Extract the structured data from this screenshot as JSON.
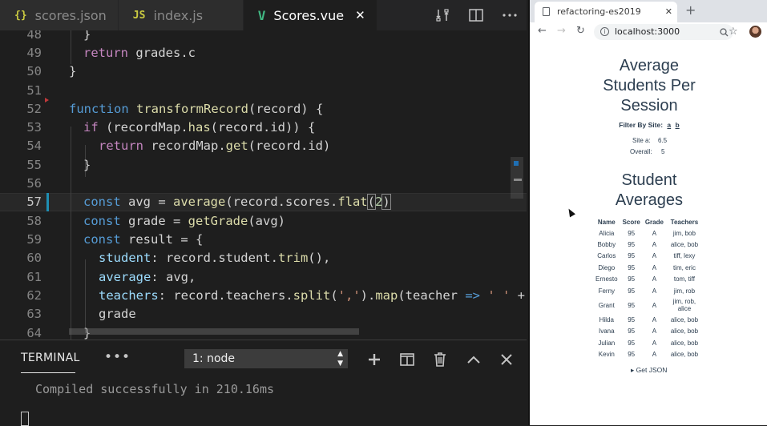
{
  "editor": {
    "tabs": [
      {
        "icon": "{}",
        "label": "scores.json",
        "icon_color": "#cbcb41"
      },
      {
        "icon": "JS",
        "label": "index.js",
        "icon_color": "#cbcb41"
      },
      {
        "icon": "V",
        "label": "Scores.vue",
        "icon_color": "#41b883"
      }
    ],
    "active_tab_close": "✕",
    "line_numbers": [
      "48",
      "49",
      "50",
      "51",
      "52",
      "53",
      "54",
      "55",
      "56",
      "57",
      "58",
      "59",
      "60",
      "61",
      "62",
      "63",
      "64"
    ],
    "code": {
      "l48": "}",
      "l49_kw": "return",
      "l49_rest": " grades.c",
      "l50": "}",
      "l52_kw": "function",
      "l52_fn": "transformRecord",
      "l52_rest": "(record) {",
      "l53_kw": "if",
      "l53_a": " (recordMap.",
      "l53_fn": "has",
      "l53_b": "(record.id)) {",
      "l54_kw": "return",
      "l54_a": " recordMap.",
      "l54_fn": "get",
      "l54_b": "(record.id)",
      "l55": "}",
      "l57_kw": "const",
      "l57_a": " avg = ",
      "l57_fn": "average",
      "l57_b": "(record.scores.",
      "l57_fn2": "flat",
      "l57_c": "(",
      "l57_num": "2",
      "l57_d": ")",
      "l58_kw": "const",
      "l58_a": " grade = ",
      "l58_fn": "getGrade",
      "l58_b": "(avg)",
      "l59_kw": "const",
      "l59_a": " result = {",
      "l60_a": "student",
      "l60_b": ": record.student.",
      "l60_fn": "trim",
      "l60_c": "(),",
      "l61_a": "average",
      "l61_b": ": avg,",
      "l62_a": "teachers",
      "l62_b": ": record.teachers.",
      "l62_fn": "split",
      "l62_c": "(",
      "l62_str": "','",
      "l62_d": ").",
      "l62_fn2": "map",
      "l62_e": "(teacher ",
      "l62_arrow": "=>",
      "l62_str2": " ' '",
      "l62_f": " +",
      "l63": "grade",
      "l64": "}"
    }
  },
  "terminal": {
    "title": "TERMINAL",
    "more": "•••",
    "select_value": "1: node",
    "output": "Compiled successfully in 210.16ms"
  },
  "browser": {
    "tab_title": "refactoring-es2019",
    "tab_close": "✕",
    "new_tab": "+",
    "url": "localhost:3000",
    "page": {
      "heading1": [
        "Average",
        "Students Per",
        "Session"
      ],
      "filter_label": "Filter By Site:",
      "filter_links": [
        "a",
        "b"
      ],
      "site_label": "Site a:",
      "site_value": "6.5",
      "overall_label": "Overall:",
      "overall_value": "5",
      "heading2": [
        "Student",
        "Averages"
      ],
      "table_headers": [
        "Name",
        "Score",
        "Grade",
        "Teachers"
      ],
      "rows": [
        {
          "name": "Alicia",
          "score": "95",
          "grade": "A",
          "teachers": "jim, bob"
        },
        {
          "name": "Bobby",
          "score": "95",
          "grade": "A",
          "teachers": "alice, bob"
        },
        {
          "name": "Carlos",
          "score": "95",
          "grade": "A",
          "teachers": "tiff, lexy"
        },
        {
          "name": "Diego",
          "score": "95",
          "grade": "A",
          "teachers": "tim, eric"
        },
        {
          "name": "Ernesto",
          "score": "95",
          "grade": "A",
          "teachers": "tom, tiff"
        },
        {
          "name": "Ferny",
          "score": "95",
          "grade": "A",
          "teachers": "jim, rob"
        },
        {
          "name": "Grant",
          "score": "95",
          "grade": "A",
          "teachers": "jim, rob, alice"
        },
        {
          "name": "Hilda",
          "score": "95",
          "grade": "A",
          "teachers": "alice, bob"
        },
        {
          "name": "Ivana",
          "score": "95",
          "grade": "A",
          "teachers": "alice, bob"
        },
        {
          "name": "Julian",
          "score": "95",
          "grade": "A",
          "teachers": "alice, bob"
        },
        {
          "name": "Kevin",
          "score": "95",
          "grade": "A",
          "teachers": "alice, bob"
        }
      ],
      "get_json": "▸ Get JSON"
    }
  }
}
